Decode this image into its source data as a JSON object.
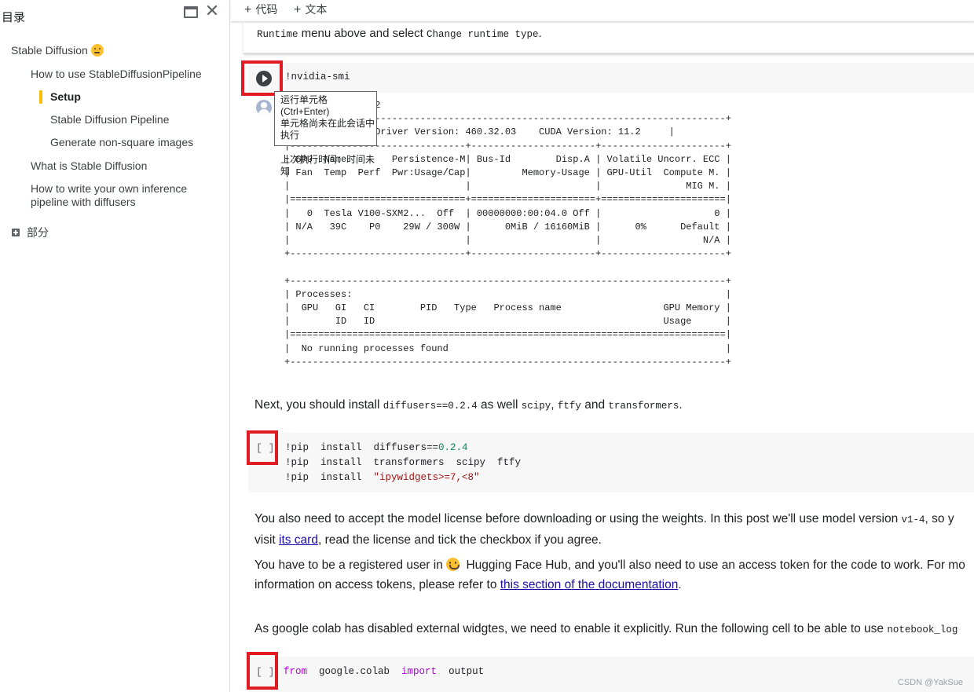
{
  "sidebar": {
    "title": "目录",
    "toc": [
      {
        "label": "Stable Diffusion",
        "level": 0,
        "emoji": "thinking-face"
      },
      {
        "label": "How to use StableDiffusionPipeline",
        "level": 1
      },
      {
        "label": "Setup",
        "level": 2,
        "active": true
      },
      {
        "label": "Stable Diffusion Pipeline",
        "level": 2
      },
      {
        "label": "Generate non-square images",
        "level": 2
      },
      {
        "label": "What is Stable Diffusion",
        "level": 1
      },
      {
        "label": "How to write your own inference",
        "level": 1
      },
      {
        "label": "pipeline with diffusers",
        "level": 1
      }
    ],
    "section_label": "部分"
  },
  "toolbar": {
    "add_code": "代码",
    "add_text": "文本"
  },
  "prev_cell": {
    "code1": "Runtime",
    "text1": " menu above and select ",
    "code2": "Change runtime type",
    "text2": "."
  },
  "cell1": {
    "code": "!nvidia-smi",
    "tooltip": {
      "line1": "运行单元格 (Ctrl+Enter)",
      "line2": "单元格尚未在此会话中执行",
      "line3": "上次执行时间：时间未知"
    },
    "output_lines": [
      "             2022",
      "+-----------------------------------------------------------------------------+",
      "           3    Driver Version: 460.32.03    CUDA Version: 11.2     |",
      "|-------------------------------+----------------------+----------------------+",
      "| GPU  Name        Persistence-M| Bus-Id        Disp.A | Volatile Uncorr. ECC |",
      "| Fan  Temp  Perf  Pwr:Usage/Cap|         Memory-Usage | GPU-Util  Compute M. |",
      "|                               |                      |               MIG M. |",
      "|===============================+======================+======================|",
      "|   0  Tesla V100-SXM2...  Off  | 00000000:00:04.0 Off |                    0 |",
      "| N/A   39C    P0    29W / 300W |      0MiB / 16160MiB |      0%      Default |",
      "|                               |                      |                  N/A |",
      "+-------------------------------+----------------------+----------------------+",
      "",
      "+-----------------------------------------------------------------------------+",
      "| Processes:                                                                  |",
      "|  GPU   GI   CI        PID   Type   Process name                  GPU Memory |",
      "|        ID   ID                                                   Usage      |",
      "|=============================================================================|",
      "|  No running processes found                                                 |",
      "+-----------------------------------------------------------------------------+"
    ]
  },
  "md1": {
    "t1": "Next, you should install ",
    "c1": "diffusers==0.2.4",
    "t2": " as well ",
    "c2": "scipy",
    "t3": ", ",
    "c3": "ftfy",
    "t4": " and ",
    "c4": "transformers",
    "t5": "."
  },
  "cell2": {
    "exec": "[ ]",
    "l1_a": "!pip  install  diffusers==",
    "l1_b": "0.2.4",
    "l2": "!pip  install  transformers  scipy  ftfy",
    "l3_a": "!pip  install  ",
    "l3_b": "\"ipywidgets>=7,<8\""
  },
  "md2": {
    "t1": "You also need to accept the model license before downloading or using the weights. In this post we'll use model version ",
    "c1": "v1-4",
    "t2": ", so y",
    "t3": "visit ",
    "link1": "its card",
    "t4": ", read the license and tick the checkbox if you agree."
  },
  "md3": {
    "t1": "You have to be a registered user in ",
    "t2": " Hugging Face Hub, and you'll also need to use an access token for the code to work. For mo",
    "t3": "information on access tokens, please refer to ",
    "link": "this section of the documentation",
    "t4": "."
  },
  "md4": {
    "t1": "As google colab has disabled external widgtes, we need to enable it explicitly. Run the following cell to be able to use ",
    "c1": "notebook_log"
  },
  "cell3": {
    "exec": "[ ]",
    "kw1": "from",
    "mod": "  google.colab  ",
    "kw2": "import",
    "name": "  output"
  },
  "watermark": "CSDN @YakSue",
  "colors": {
    "highlight_box": "#e01b24",
    "active_toc_bar": "#fbbc04",
    "link": "#1a0dab"
  }
}
